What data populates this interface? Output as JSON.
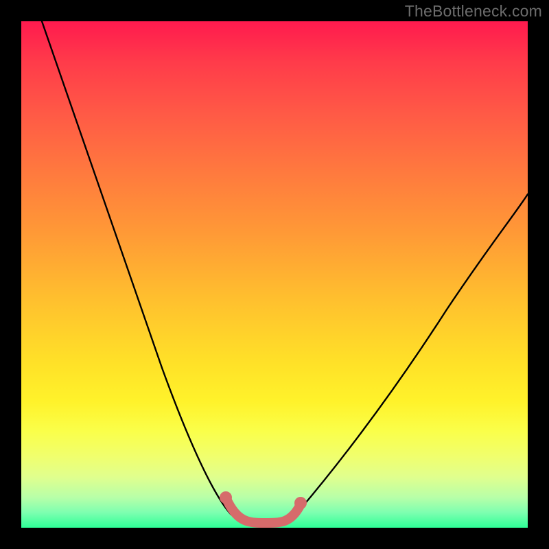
{
  "watermark": "TheBottleneck.com",
  "colors": {
    "black": "#000000",
    "curve": "#000000",
    "highlight": "#d66b6b",
    "gradient_top": "#ff1a4e",
    "gradient_bottom": "#2eff97"
  },
  "chart_data": {
    "type": "line",
    "title": "",
    "xlabel": "",
    "ylabel": "",
    "xlim": [
      0,
      100
    ],
    "ylim": [
      0,
      100
    ],
    "grid": false,
    "legend": false,
    "note": "Bottleneck-style V-curve; values estimated from pixel geometry. Lower y = better (closer to green band). Trough at roughly x≈43–51 sits near y≈1–2.",
    "series": [
      {
        "name": "curve",
        "x": [
          4,
          8,
          12,
          16,
          20,
          24,
          28,
          32,
          36,
          40,
          43,
          45,
          47,
          49,
          51,
          54,
          58,
          64,
          72,
          82,
          92,
          100
        ],
        "y": [
          100,
          90,
          80,
          69,
          58,
          47,
          36,
          26,
          16,
          8,
          3,
          1.5,
          1,
          1,
          1.5,
          4,
          9,
          18,
          31,
          46,
          58,
          66
        ]
      },
      {
        "name": "highlight-segment",
        "x": [
          40.5,
          42,
          44,
          46,
          48,
          50,
          51.5,
          53.5
        ],
        "y": [
          5,
          3,
          1.6,
          1.2,
          1.2,
          1.6,
          3,
          6
        ]
      }
    ],
    "highlight_endpoints": [
      {
        "x": 40.5,
        "y": 5
      },
      {
        "x": 53.5,
        "y": 6
      }
    ]
  }
}
